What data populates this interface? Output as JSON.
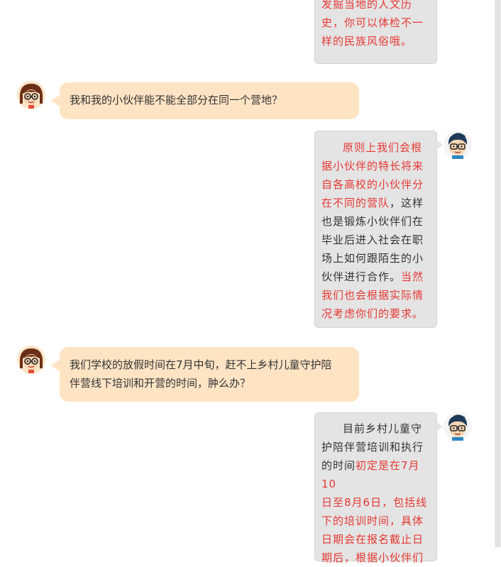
{
  "messages": {
    "m1": {
      "lines": [
        "发掘当地的人文历",
        "史，你可以体检不一",
        "样的民族风俗哦。"
      ]
    },
    "m2": {
      "text": "我和我的小伙伴能不能全部分在同一个营地？"
    },
    "m3": {
      "lines": [
        "原则上我们会根",
        "据小伙伴的特长将来",
        "自各高校的小伙伴分",
        "在不同的营队",
        "，这样",
        "也是锻炼小伙伴们在",
        "毕业后进入社会在职",
        "场上如何跟陌生的小",
        "伙伴进行合作。",
        "当然",
        "我们也会根据实际情",
        "况考虑你们的要求。"
      ]
    },
    "m4": {
      "lines": [
        "我们学校的放假时间在7月中旬，赶不上乡村儿童守护陪",
        "伴营线下培训和开营的时间，肿么办？"
      ]
    },
    "m5": {
      "lines": [
        "目前乡村儿童守",
        "护陪伴营培训和执行",
        "的时间",
        "初定是在7月10",
        "日至8月6日，包括线",
        "下的培训时间，具体",
        "日期会在报名截止日",
        "期后，根据小伙伴们"
      ]
    }
  },
  "colors": {
    "highlight": "#e53935",
    "user_bubble": "#ffe4c4",
    "reply_bubble": "#e4e4e4"
  },
  "avatars": {
    "user": "girl-avatar-icon",
    "staff": "boy-avatar-icon"
  }
}
